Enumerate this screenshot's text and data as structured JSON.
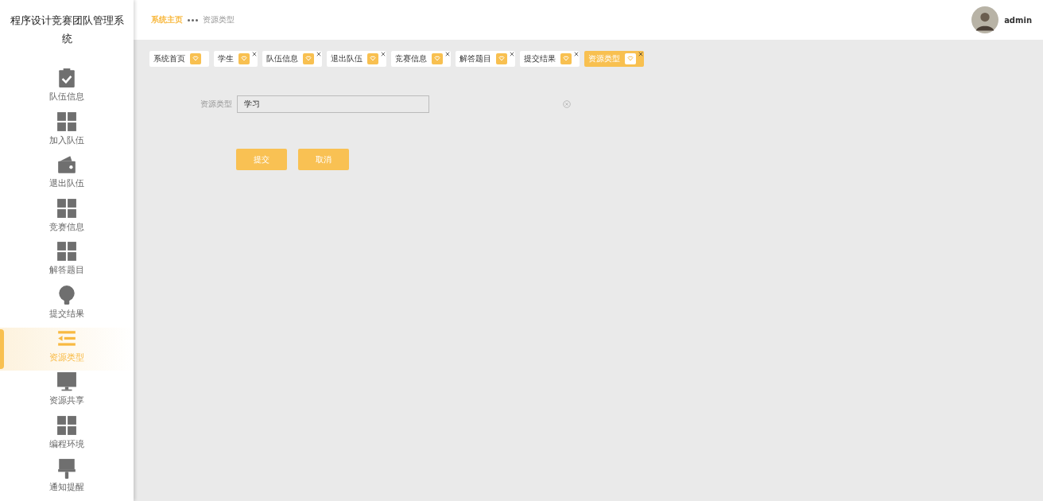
{
  "sidebar": {
    "title": "程序设计竞赛团队管理系统",
    "items": [
      {
        "label": "队伍信息",
        "kind": "clipboard",
        "selected": false
      },
      {
        "label": "加入队伍",
        "kind": "grid",
        "selected": false
      },
      {
        "label": "退出队伍",
        "kind": "wallet",
        "selected": false
      },
      {
        "label": "竞赛信息",
        "kind": "grid",
        "selected": false
      },
      {
        "label": "解答题目",
        "kind": "grid",
        "selected": false
      },
      {
        "label": "提交结果",
        "kind": "bulb",
        "selected": false
      },
      {
        "label": "资源类型",
        "kind": "list",
        "selected": true
      },
      {
        "label": "资源共享",
        "kind": "monitor",
        "selected": false
      },
      {
        "label": "编程环境",
        "kind": "grid",
        "selected": false
      },
      {
        "label": "通知提醒",
        "kind": "brush",
        "selected": false
      }
    ]
  },
  "breadcrumb": [
    "系统主页",
    "资源类型"
  ],
  "user": {
    "name": "admin"
  },
  "tabs": [
    {
      "label": "系统首页",
      "selected": false,
      "closable": false
    },
    {
      "label": "学生",
      "selected": false,
      "closable": true
    },
    {
      "label": "队伍信息",
      "selected": false,
      "closable": true
    },
    {
      "label": "退出队伍",
      "selected": false,
      "closable": true
    },
    {
      "label": "竞赛信息",
      "selected": false,
      "closable": true
    },
    {
      "label": "解答题目",
      "selected": false,
      "closable": true
    },
    {
      "label": "提交结果",
      "selected": false,
      "closable": true
    },
    {
      "label": "资源类型",
      "selected": true,
      "closable": true
    }
  ],
  "form": {
    "label": "资源类型",
    "value": "学习"
  },
  "buttons": [
    "提交",
    "取消"
  ]
}
